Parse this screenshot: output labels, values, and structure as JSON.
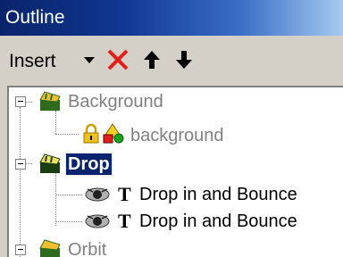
{
  "window": {
    "title": "Outline"
  },
  "toolbar": {
    "insert_label": "Insert",
    "icons": [
      "dropdown-arrow-icon",
      "delete-x-icon",
      "move-up-icon",
      "move-down-icon"
    ]
  },
  "tree": {
    "nodes": [
      {
        "label": "Background",
        "icon": "scene-clapper-icon",
        "state": "expanded",
        "dimmed": true
      },
      {
        "label": "background",
        "icons": [
          "lock-icon",
          "shapes-icon"
        ],
        "dimmed": true
      },
      {
        "label": "Drop",
        "icon": "scene-clapper-icon",
        "state": "expanded",
        "selected": true
      },
      {
        "label": "Drop in and Bounce",
        "icons": [
          "eye-icon",
          "text-icon"
        ]
      },
      {
        "label": "Drop in and Bounce",
        "icons": [
          "eye-icon",
          "text-icon"
        ]
      },
      {
        "label": "Orbit",
        "icon": "scene-clapper-icon",
        "state": "expanded",
        "dimmed": true
      }
    ]
  },
  "colors": {
    "title_gradient_start": "#0a246a",
    "title_gradient_end": "#a6caf0",
    "selection": "#0a246a",
    "delete": "#e0201a"
  }
}
